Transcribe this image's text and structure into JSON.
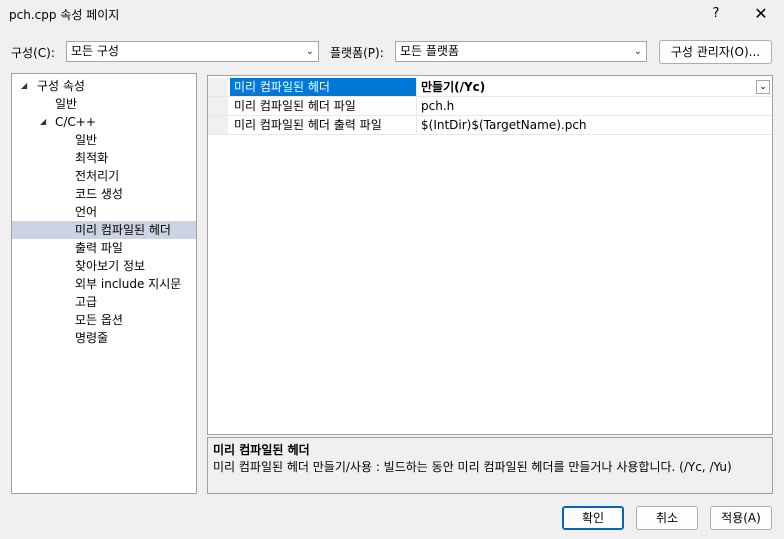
{
  "window": {
    "title": "pch.cpp 속성 페이지",
    "help": "?",
    "close": "✕"
  },
  "toolbar": {
    "config_label": "구성(C):",
    "config_value": "모든 구성",
    "platform_label": "플랫폼(P):",
    "platform_value": "모든 플랫폼",
    "config_manager": "구성 관리자(O)..."
  },
  "tree": {
    "root": "구성 속성",
    "general": "일반",
    "cpp": "C/C++",
    "items": [
      "일반",
      "최적화",
      "전처리기",
      "코드 생성",
      "언어",
      "미리 컴파일된 헤더",
      "출력 파일",
      "찾아보기 정보",
      "외부 include 지시문",
      "고급",
      "모든 옵션",
      "명령줄"
    ],
    "selected_index": 5
  },
  "grid": {
    "rows": [
      {
        "name": "미리 컴파일된 헤더",
        "value": "만들기(/Yc)"
      },
      {
        "name": "미리 컴파일된 헤더 파일",
        "value": "pch.h"
      },
      {
        "name": "미리 컴파일된 헤더 출력 파일",
        "value": "$(IntDir)$(TargetName).pch"
      }
    ]
  },
  "description": {
    "title": "미리 컴파일된 헤더",
    "text": "미리 컴파일된 헤더 만들기/사용 : 빌드하는 동안 미리 컴파일된 헤더를 만들거나 사용합니다.      (/Yc, /Yu)"
  },
  "buttons": {
    "ok": "확인",
    "cancel": "취소",
    "apply": "적용(A)"
  }
}
